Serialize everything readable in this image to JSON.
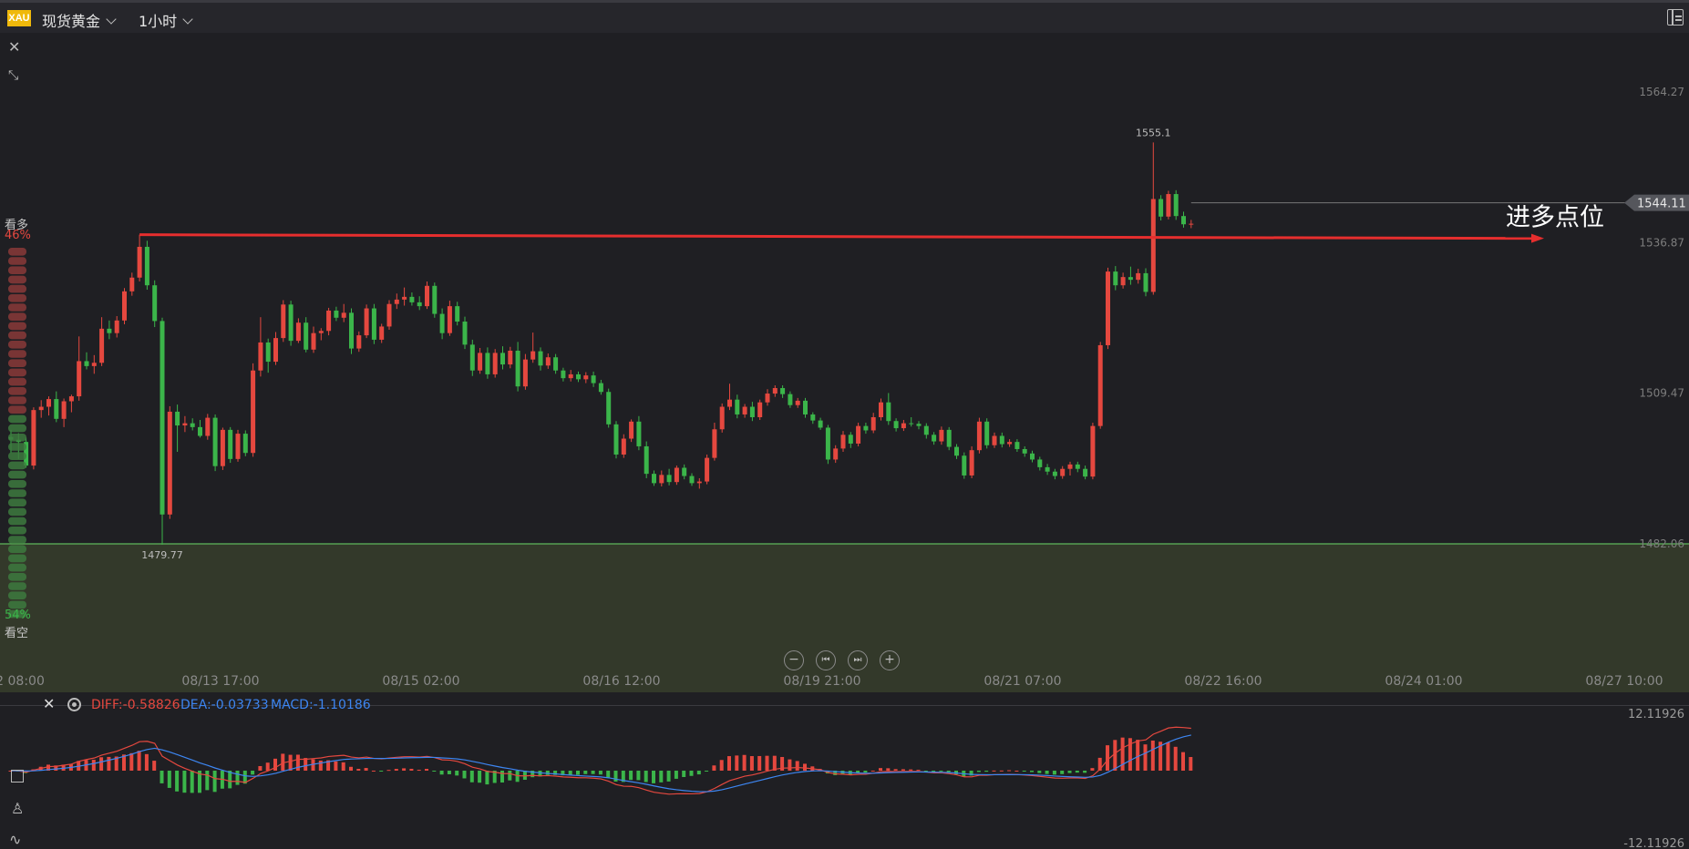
{
  "header": {
    "symbol_badge": "XAU",
    "symbol_name": "现货黄金",
    "period": "1小时"
  },
  "sentiment": {
    "bull_label": "看多",
    "bull_pct": "46%",
    "bear_pct": "54%",
    "bear_label": "看空",
    "bull_fraction": 0.46
  },
  "controls": {
    "zoom_out": "−",
    "prev": "⏮",
    "next": "⏭",
    "zoom_in": "+"
  },
  "chart_data": {
    "type": "candlestick",
    "symbol": "现货黄金",
    "y_ticks": [
      "1564.27",
      "1536.87",
      "1509.47",
      "1482.06"
    ],
    "y_tick_values": [
      1564.27,
      1536.87,
      1509.47,
      1482.06
    ],
    "x_ticks": [
      "2 08:00",
      "08/13 17:00",
      "08/15 02:00",
      "08/16 12:00",
      "08/19 21:00",
      "08/21 07:00",
      "08/22 16:00",
      "08/24 01:00",
      "08/27 10:00"
    ],
    "high_label": "1555.1",
    "low_label": "1479.77",
    "current_price": "1544.11",
    "horizontal_line_price": 1482.06,
    "annotation": "进多点位",
    "colors": {
      "up": "#e5483f",
      "down": "#3bb54a",
      "arrow": "#e62e2e",
      "support": "#5fb85c"
    },
    "candles": [
      [
        1501.5,
        1502.8,
        1498.6,
        1501.0
      ],
      [
        1501.0,
        1502.2,
        1497.5,
        1500.6
      ],
      [
        1500.6,
        1501.4,
        1495.9,
        1496.3
      ],
      [
        1496.3,
        1506.9,
        1495.6,
        1506.4
      ],
      [
        1506.4,
        1508.2,
        1505.0,
        1507.0
      ],
      [
        1507.0,
        1508.9,
        1505.4,
        1508.4
      ],
      [
        1508.4,
        1509.8,
        1504.2,
        1504.8
      ],
      [
        1504.8,
        1508.5,
        1503.3,
        1508.0
      ],
      [
        1508.0,
        1509.2,
        1506.0,
        1508.9
      ],
      [
        1508.9,
        1519.8,
        1508.1,
        1515.3
      ],
      [
        1515.3,
        1516.9,
        1513.8,
        1514.4
      ],
      [
        1514.4,
        1516.4,
        1513.0,
        1515.0
      ],
      [
        1515.0,
        1523.3,
        1514.4,
        1521.2
      ],
      [
        1521.2,
        1522.7,
        1519.3,
        1520.4
      ],
      [
        1520.4,
        1523.5,
        1519.6,
        1522.7
      ],
      [
        1522.7,
        1528.6,
        1522.0,
        1528.0
      ],
      [
        1528.0,
        1531.4,
        1527.2,
        1530.5
      ],
      [
        1530.5,
        1538.3,
        1529.8,
        1536.1
      ],
      [
        1536.1,
        1537.2,
        1528.3,
        1529.1
      ],
      [
        1529.1,
        1530.0,
        1521.5,
        1522.6
      ],
      [
        1522.6,
        1523.2,
        1481.9,
        1487.4
      ],
      [
        1487.4,
        1507.1,
        1486.6,
        1506.1
      ],
      [
        1506.1,
        1507.4,
        1498.8,
        1503.6
      ],
      [
        1503.6,
        1505.3,
        1502.4,
        1504.0
      ],
      [
        1504.0,
        1504.9,
        1502.7,
        1503.3
      ],
      [
        1503.3,
        1504.6,
        1501.4,
        1501.7
      ],
      [
        1501.7,
        1505.7,
        1501.0,
        1505.0
      ],
      [
        1505.0,
        1505.6,
        1495.3,
        1496.2
      ],
      [
        1496.2,
        1503.2,
        1495.5,
        1502.8
      ],
      [
        1502.8,
        1503.3,
        1496.8,
        1497.5
      ],
      [
        1497.5,
        1502.8,
        1497.0,
        1502.1
      ],
      [
        1502.1,
        1502.7,
        1498.0,
        1498.6
      ],
      [
        1498.6,
        1514.9,
        1497.9,
        1513.6
      ],
      [
        1513.6,
        1523.3,
        1512.5,
        1518.7
      ],
      [
        1518.7,
        1519.4,
        1513.2,
        1515.2
      ],
      [
        1515.2,
        1520.6,
        1514.6,
        1519.5
      ],
      [
        1519.5,
        1526.4,
        1518.8,
        1525.6
      ],
      [
        1525.6,
        1526.3,
        1518.1,
        1519.0
      ],
      [
        1519.0,
        1523.1,
        1518.6,
        1522.3
      ],
      [
        1522.3,
        1523.3,
        1516.9,
        1517.4
      ],
      [
        1517.4,
        1521.6,
        1516.8,
        1520.4
      ],
      [
        1520.4,
        1521.3,
        1519.1,
        1520.8
      ],
      [
        1520.8,
        1525.0,
        1520.0,
        1524.5
      ],
      [
        1524.5,
        1525.2,
        1522.6,
        1523.2
      ],
      [
        1523.2,
        1525.7,
        1522.4,
        1524.1
      ],
      [
        1524.1,
        1524.9,
        1516.6,
        1517.6
      ],
      [
        1517.6,
        1520.7,
        1517.0,
        1520.0
      ],
      [
        1520.0,
        1525.6,
        1519.5,
        1524.9
      ],
      [
        1524.9,
        1525.7,
        1518.4,
        1519.2
      ],
      [
        1519.2,
        1522.1,
        1518.6,
        1521.6
      ],
      [
        1521.6,
        1526.4,
        1521.0,
        1525.7
      ],
      [
        1525.7,
        1527.6,
        1524.8,
        1526.5
      ],
      [
        1526.5,
        1528.7,
        1525.4,
        1527.0
      ],
      [
        1527.0,
        1527.8,
        1525.4,
        1526.0
      ],
      [
        1526.0,
        1527.1,
        1524.6,
        1525.3
      ],
      [
        1525.3,
        1529.8,
        1524.8,
        1529.0
      ],
      [
        1529.0,
        1529.6,
        1523.2,
        1523.9
      ],
      [
        1523.9,
        1524.9,
        1519.3,
        1520.4
      ],
      [
        1520.4,
        1526.3,
        1519.9,
        1525.3
      ],
      [
        1525.3,
        1526.1,
        1521.8,
        1522.5
      ],
      [
        1522.5,
        1523.4,
        1517.5,
        1518.3
      ],
      [
        1518.3,
        1519.2,
        1512.6,
        1513.6
      ],
      [
        1513.6,
        1517.7,
        1513.0,
        1516.8
      ],
      [
        1516.8,
        1517.8,
        1512.1,
        1512.9
      ],
      [
        1512.9,
        1517.5,
        1512.3,
        1516.8
      ],
      [
        1516.8,
        1518.0,
        1513.8,
        1514.7
      ],
      [
        1514.7,
        1517.9,
        1514.0,
        1517.2
      ],
      [
        1517.2,
        1518.8,
        1509.8,
        1510.7
      ],
      [
        1510.7,
        1516.6,
        1510.1,
        1515.6
      ],
      [
        1515.6,
        1520.5,
        1515.0,
        1517.1
      ],
      [
        1517.1,
        1517.8,
        1513.6,
        1514.5
      ],
      [
        1514.5,
        1516.7,
        1513.9,
        1516.0
      ],
      [
        1516.0,
        1516.6,
        1513.0,
        1513.6
      ],
      [
        1513.6,
        1514.1,
        1511.6,
        1512.2
      ],
      [
        1512.2,
        1513.7,
        1511.6,
        1512.9
      ],
      [
        1512.9,
        1513.4,
        1511.5,
        1512.0
      ],
      [
        1512.0,
        1513.3,
        1511.3,
        1512.7
      ],
      [
        1512.7,
        1513.4,
        1510.6,
        1511.3
      ],
      [
        1511.3,
        1511.9,
        1509.2,
        1509.7
      ],
      [
        1509.7,
        1510.3,
        1503.2,
        1503.8
      ],
      [
        1503.8,
        1504.4,
        1497.6,
        1498.3
      ],
      [
        1498.3,
        1502.0,
        1497.7,
        1501.2
      ],
      [
        1501.2,
        1504.7,
        1500.6,
        1504.3
      ],
      [
        1504.3,
        1505.3,
        1499.1,
        1499.8
      ],
      [
        1499.8,
        1500.7,
        1494.0,
        1494.8
      ],
      [
        1494.8,
        1495.4,
        1492.6,
        1493.1
      ],
      [
        1493.1,
        1495.4,
        1492.5,
        1494.6
      ],
      [
        1494.6,
        1495.7,
        1492.7,
        1493.3
      ],
      [
        1493.3,
        1496.3,
        1492.8,
        1495.9
      ],
      [
        1495.9,
        1496.5,
        1493.8,
        1494.4
      ],
      [
        1494.4,
        1494.9,
        1492.6,
        1493.1
      ],
      [
        1493.1,
        1494.0,
        1492.1,
        1493.4
      ],
      [
        1493.4,
        1498.3,
        1492.9,
        1497.7
      ],
      [
        1497.7,
        1504.1,
        1497.2,
        1502.9
      ],
      [
        1502.9,
        1507.6,
        1502.3,
        1507.0
      ],
      [
        1507.0,
        1511.2,
        1506.4,
        1508.3
      ],
      [
        1508.3,
        1509.2,
        1504.9,
        1505.6
      ],
      [
        1505.6,
        1507.5,
        1505.0,
        1507.0
      ],
      [
        1507.0,
        1507.9,
        1504.4,
        1505.1
      ],
      [
        1505.1,
        1508.3,
        1504.6,
        1507.8
      ],
      [
        1507.8,
        1510.2,
        1507.2,
        1509.4
      ],
      [
        1509.4,
        1510.9,
        1508.8,
        1510.4
      ],
      [
        1510.4,
        1510.9,
        1508.6,
        1509.3
      ],
      [
        1509.3,
        1509.8,
        1506.8,
        1507.3
      ],
      [
        1507.3,
        1508.6,
        1506.8,
        1508.1
      ],
      [
        1508.1,
        1508.6,
        1505.0,
        1505.6
      ],
      [
        1505.6,
        1506.0,
        1503.9,
        1504.5
      ],
      [
        1504.5,
        1505.0,
        1502.8,
        1503.2
      ],
      [
        1503.2,
        1503.7,
        1496.6,
        1497.4
      ],
      [
        1497.4,
        1500.0,
        1496.8,
        1499.4
      ],
      [
        1499.4,
        1502.6,
        1498.8,
        1501.9
      ],
      [
        1501.9,
        1502.4,
        1499.5,
        1500.3
      ],
      [
        1500.3,
        1504.1,
        1499.8,
        1503.5
      ],
      [
        1503.5,
        1504.1,
        1502.1,
        1502.7
      ],
      [
        1502.7,
        1505.9,
        1502.2,
        1505.1
      ],
      [
        1505.1,
        1508.5,
        1504.5,
        1507.8
      ],
      [
        1507.8,
        1509.5,
        1503.7,
        1504.4
      ],
      [
        1504.4,
        1504.9,
        1502.5,
        1503.1
      ],
      [
        1503.1,
        1504.6,
        1502.6,
        1504.0
      ],
      [
        1504.0,
        1505.1,
        1503.4,
        1503.9
      ],
      [
        1503.9,
        1504.4,
        1502.9,
        1503.5
      ],
      [
        1503.5,
        1504.0,
        1501.2,
        1501.9
      ],
      [
        1501.9,
        1502.4,
        1500.1,
        1500.7
      ],
      [
        1500.7,
        1503.4,
        1500.1,
        1502.8
      ],
      [
        1502.8,
        1503.3,
        1499.1,
        1499.7
      ],
      [
        1499.7,
        1500.2,
        1497.5,
        1498.1
      ],
      [
        1498.1,
        1498.7,
        1493.9,
        1494.5
      ],
      [
        1494.5,
        1499.8,
        1494.0,
        1499.1
      ],
      [
        1499.1,
        1505.0,
        1498.5,
        1504.3
      ],
      [
        1504.3,
        1504.9,
        1499.4,
        1500.0
      ],
      [
        1500.0,
        1502.3,
        1499.5,
        1501.7
      ],
      [
        1501.7,
        1502.3,
        1499.6,
        1500.2
      ],
      [
        1500.2,
        1501.1,
        1499.7,
        1500.6
      ],
      [
        1500.6,
        1501.1,
        1498.8,
        1499.3
      ],
      [
        1499.3,
        1499.8,
        1497.9,
        1498.5
      ],
      [
        1498.5,
        1499.0,
        1496.9,
        1497.4
      ],
      [
        1497.4,
        1497.9,
        1495.4,
        1496.0
      ],
      [
        1496.0,
        1496.6,
        1494.6,
        1495.2
      ],
      [
        1495.2,
        1495.7,
        1493.8,
        1494.4
      ],
      [
        1494.4,
        1496.2,
        1493.9,
        1495.7
      ],
      [
        1495.7,
        1497.0,
        1494.5,
        1496.5
      ],
      [
        1496.5,
        1497.0,
        1495.1,
        1495.7
      ],
      [
        1495.7,
        1496.3,
        1493.8,
        1494.3
      ],
      [
        1494.3,
        1504.1,
        1493.8,
        1503.5
      ],
      [
        1503.5,
        1518.8,
        1503.0,
        1518.2
      ],
      [
        1518.2,
        1532.3,
        1517.5,
        1531.6
      ],
      [
        1531.6,
        1532.6,
        1528.2,
        1529.1
      ],
      [
        1529.1,
        1531.4,
        1528.5,
        1530.6
      ],
      [
        1530.6,
        1532.5,
        1529.2,
        1530.1
      ],
      [
        1530.1,
        1532.1,
        1529.4,
        1531.3
      ],
      [
        1531.3,
        1532.2,
        1527.1,
        1527.9
      ],
      [
        1527.9,
        1555.1,
        1527.4,
        1544.8
      ],
      [
        1544.8,
        1545.5,
        1540.9,
        1541.6
      ],
      [
        1541.6,
        1546.3,
        1541.1,
        1545.7
      ],
      [
        1545.7,
        1546.4,
        1541.0,
        1541.7
      ],
      [
        1541.7,
        1542.5,
        1539.6,
        1540.2
      ],
      [
        1540.2,
        1541.0,
        1539.5,
        1540.3
      ]
    ],
    "macd": {
      "diff": "DIFF:-0.58826",
      "dea": "DEA:-0.03733",
      "macd": "MACD:-1.10186",
      "y_max": "12.11926",
      "y_min": "-12.11926",
      "y_max_value": 12.11926,
      "y_min_value": -12.11926,
      "colors": {
        "diff": "#e5483f",
        "dea": "#3d86f2",
        "pos": "#e5483f",
        "neg": "#3bb54a"
      }
    }
  }
}
